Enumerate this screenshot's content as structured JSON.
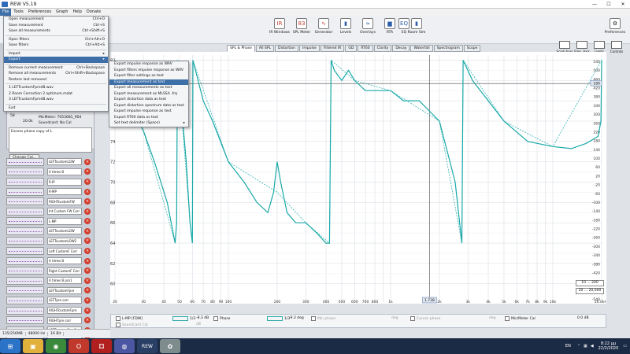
{
  "window": {
    "title": "REW V5.19",
    "controls": [
      "—",
      "☐",
      "✕"
    ]
  },
  "menubar": [
    "File",
    "Tools",
    "Preferences",
    "Graph",
    "Help",
    "Donate"
  ],
  "toolbar": [
    {
      "label": "IR Windows",
      "glyph": "IR",
      "icon": "ir-windows-icon",
      "left": 342
    },
    {
      "label": "SPL Meter",
      "glyph": "83",
      "icon": "spl-meter-icon",
      "left": 370
    },
    {
      "label": "Generator",
      "glyph": "∿",
      "icon": "generator-icon",
      "left": 398
    },
    {
      "label": "Levels",
      "glyph": "▮",
      "icon": "levels-icon",
      "left": 426
    },
    {
      "label": "Overlays",
      "glyph": "≈",
      "icon": "overlays-icon",
      "left": 454
    },
    {
      "label": "RTA",
      "glyph": "▆",
      "icon": "rta-icon",
      "left": 482
    },
    {
      "label": "EQ",
      "glyph": "EQ",
      "icon": "eq-icon",
      "left": 500
    },
    {
      "label": "Room Sim",
      "glyph": "▮",
      "icon": "room-sim-icon",
      "left": 516
    }
  ],
  "preferences_label": "Preferences",
  "tabs": [
    "SPL & Phase",
    "All SPL",
    "Distortion",
    "Impulse",
    "Filtered IR",
    "GD",
    "RT60",
    "Clarity",
    "Decay",
    "Waterfall",
    "Spectrogram",
    "Scope"
  ],
  "active_tab": 0,
  "right_buttons": [
    "Scroll bars",
    "Freq. Axis",
    "Limits",
    "Controls"
  ],
  "file_menu": [
    {
      "label": "Open measurement",
      "shortcut": "Ctrl+O"
    },
    {
      "label": "Save measurement",
      "shortcut": "Ctrl+S"
    },
    {
      "label": "Save all measurements",
      "shortcut": "Ctrl+Shift+S"
    },
    {
      "sep": true
    },
    {
      "label": "Open filters",
      "shortcut": "Ctrl+Alt+O"
    },
    {
      "label": "Save filters",
      "shortcut": "Ctrl+Alt+S"
    },
    {
      "sep": true
    },
    {
      "label": "Import",
      "shortcut": "▸"
    },
    {
      "label": "Export",
      "shortcut": "▸",
      "highlight": true
    },
    {
      "sep": true
    },
    {
      "label": "Remove current measurement",
      "shortcut": "Ctrl+Backspace"
    },
    {
      "label": "Remove all measurements",
      "shortcut": "Ctrl+Shift+Backspace"
    },
    {
      "label": "Restore last removed",
      "shortcut": ""
    },
    {
      "sep": true
    },
    {
      "label": "1 LEFTcustomFpre48.wav",
      "shortcut": ""
    },
    {
      "label": "2 Room Correction 2 optimum.mdat",
      "shortcut": ""
    },
    {
      "label": "3 LEFTcustomFpre48.wav",
      "shortcut": ""
    },
    {
      "sep": true
    },
    {
      "label": "Exit",
      "shortcut": ""
    }
  ],
  "export_menu": [
    {
      "label": "Export impulse response as WAV"
    },
    {
      "label": "Export filters impulse response as WAV"
    },
    {
      "label": "Export filter settings as text"
    },
    {
      "label": "Export measurement as text",
      "highlight": true
    },
    {
      "label": "Export all measurements as text"
    },
    {
      "label": "Export measurement as MLSSA .frq"
    },
    {
      "label": "Export distortion data as text"
    },
    {
      "label": "Export distortion spectrum data as text"
    },
    {
      "label": "Export impulse response as text"
    },
    {
      "label": "Export RT60 data as text"
    },
    {
      "label": "Set text delimiter (Space)",
      "shortcut": "▸"
    }
  ],
  "info": {
    "mic_meter": "MicMeter: 7053681_90d",
    "soundcard": "Soundcard: No Cal",
    "left_values": [
      "58",
      "20.0k"
    ],
    "note": "Excess phase copy of L",
    "change_cal": "Change Cal..."
  },
  "measurements": [
    "LEFTcustomLOW",
    "A times B",
    "R-IP",
    "R-MP",
    "RIGHTcustomFW",
    "Int Custom FW Corr",
    "L-MP",
    "LEFTcustomLOW",
    "LEFTcustomLOW2",
    "Left CustomF Corr",
    "A times B",
    "Right CustomF Corr",
    "A times B pro1",
    "LEFTcustomFpre",
    "LEFTpre corr",
    "RIGHTcustomFpre",
    "RIGHTpre corr",
    "LEFTcustomFpre2",
    "LEFTpre2 corr"
  ],
  "chart_data": {
    "type": "line",
    "series": [
      {
        "name": "L-MP [FDW]",
        "color": "#1aa8a8",
        "x": [
          20,
          24,
          30,
          35,
          42,
          47,
          48,
          48.5,
          55,
          58,
          60,
          60.5,
          70,
          80,
          100,
          125,
          150,
          175,
          190,
          200,
          210,
          230,
          260,
          300,
          350,
          400,
          420,
          430,
          450,
          500,
          550,
          600,
          700,
          800,
          1000,
          1200,
          1500,
          2000,
          2500,
          2750,
          2800,
          3200,
          4000,
          5000,
          7000,
          10000,
          13000,
          16000,
          19000,
          19800,
          20000
        ],
        "y": [
          82,
          78,
          75,
          72,
          68,
          64,
          66,
          82,
          72,
          66,
          64,
          82,
          78,
          76,
          72,
          70,
          68,
          67,
          69,
          72,
          70,
          67,
          66,
          66,
          65,
          64,
          64,
          82,
          81,
          80,
          81,
          80,
          79,
          79,
          79,
          78,
          78,
          76,
          70,
          64,
          82,
          80,
          78,
          76,
          74,
          73.5,
          73.3,
          73.8,
          74.5,
          76,
          82
        ]
      },
      {
        "name": "Phase",
        "color": "#1aa8a8",
        "x": [
          20,
          30,
          40,
          47,
          48,
          48.5,
          58,
          60,
          60.5,
          100,
          200,
          300,
          420,
          430,
          600,
          1000,
          2000,
          2750,
          2800,
          5000,
          10000,
          20000
        ],
        "y": [
          82,
          75,
          68,
          64,
          66,
          82,
          66,
          64,
          82,
          72,
          69,
          66,
          64,
          82,
          80,
          79,
          76,
          64,
          82,
          76,
          73.5,
          82
        ]
      }
    ],
    "x_ticks": [
      "20",
      "30",
      "40",
      "50",
      "60",
      "70",
      "80",
      "90",
      "100",
      "200",
      "300",
      "400",
      "500",
      "600",
      "700",
      "800",
      "1k",
      "2k",
      "3k",
      "4k",
      "5k",
      "6k",
      "7k",
      "8k",
      "9k",
      "10k",
      "20.0kHz"
    ],
    "y_ticks_left": [
      "82",
      "80",
      "78",
      "76",
      "74",
      "72",
      "70",
      "68",
      "66",
      "64",
      "62",
      "60"
    ],
    "y_ticks_right": [
      "540",
      "500",
      "460",
      "420",
      "380",
      "340",
      "300",
      "260",
      "220",
      "180",
      "140",
      "100",
      "60",
      "20",
      "-20",
      "-60",
      "-100",
      "-140",
      "-180",
      "-220",
      "-260",
      "-300",
      "-340",
      "-380",
      "-420",
      "-460",
      "-500",
      "-540"
    ],
    "ylim": [
      58.2,
      82.5
    ],
    "xlim": [
      20,
      20000
    ],
    "log_x": true,
    "cursor_y_label": "79.70",
    "cursor_x_label": "1.738",
    "cursor_x": 1738,
    "cursor_y": 79.7,
    "right_axis_marker": "180"
  },
  "legend": {
    "series_name": "L-MP [FDW]",
    "smoothing1": "1/3",
    "value1": "-8.3 dB",
    "phase_label": "Phase",
    "smoothing2": "1/3",
    "value2": "-9.3 deg",
    "min_phase": "Min phase",
    "deg1": "deg",
    "excess_phase": "Excess phase",
    "deg2": "deg",
    "mic_meter_cal": "Mic/Meter Cal",
    "cal_value": "0.0 dB",
    "soundcard_cal": "Soundcard Cal",
    "sc_value": "dB"
  },
  "range_buttons": [
    "10 ... 200",
    "20 ... 20,000"
  ],
  "statusbar": [
    "135/256MB",
    "48000 Hz",
    "16 Bit"
  ],
  "taskbar": {
    "apps": [
      {
        "icon": "windows-start-icon",
        "glyph": "⊞",
        "bg": "#2b73c7"
      },
      {
        "icon": "file-explorer-icon",
        "glyph": "▣",
        "bg": "#e2b13b"
      },
      {
        "icon": "chrome-icon",
        "glyph": "◉",
        "bg": "#3b8a3b"
      },
      {
        "icon": "opera-icon",
        "glyph": "O",
        "bg": "#c0392b"
      },
      {
        "icon": "dice-app-icon",
        "glyph": "⚃",
        "bg": "#b21f1f"
      },
      {
        "icon": "media-app-icon",
        "glyph": "◍",
        "bg": "#4b57a3"
      },
      {
        "icon": "rew-icon",
        "glyph": "REW",
        "bg": "#2a3f66"
      },
      {
        "icon": "paint-icon",
        "glyph": "✿",
        "bg": "#7f8c8d"
      }
    ],
    "lang": "EN",
    "time": "8:22 μμ",
    "date": "22/2/2020"
  }
}
